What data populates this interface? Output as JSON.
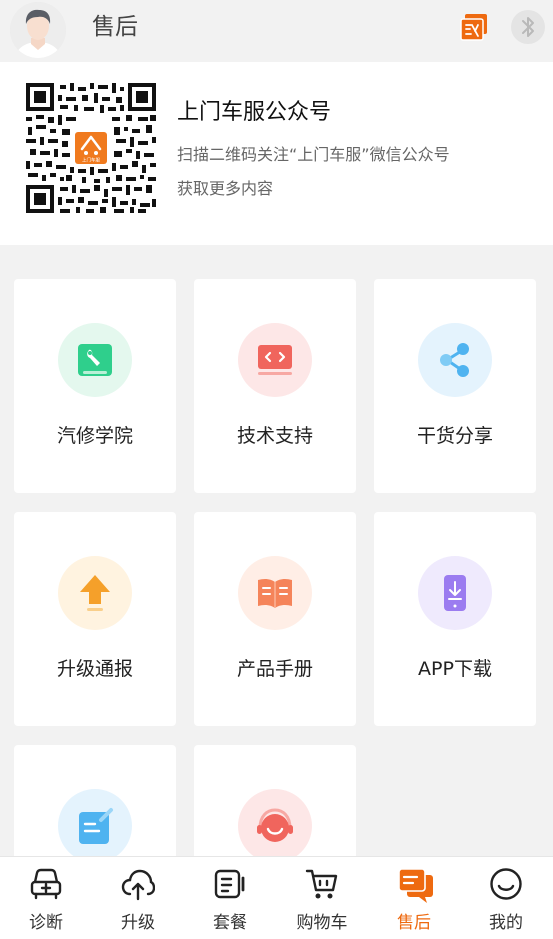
{
  "header": {
    "title": "售后"
  },
  "qr_card": {
    "title": "上门车服公众号",
    "subtitle": "扫描二维码关注“上门车服”微信公众号",
    "more": "获取更多内容",
    "logo_text": "上门车服"
  },
  "grid": {
    "items": [
      {
        "label": "汽修学院",
        "icon": "wrench-book-icon",
        "bg": "#e4f8ee",
        "color": "#2fcf8c"
      },
      {
        "label": "技术支持",
        "icon": "code-laptop-icon",
        "bg": "#fde7e7",
        "color": "#f0655d"
      },
      {
        "label": "干货分享",
        "icon": "share-icon",
        "bg": "#e4f3fd",
        "color": "#4fb3f0"
      },
      {
        "label": "升级通报",
        "icon": "upgrade-arrow-icon",
        "bg": "#fff3e0",
        "color": "#f5a02a"
      },
      {
        "label": "产品手册",
        "icon": "manual-book-icon",
        "bg": "#ffeee6",
        "color": "#f5845a"
      },
      {
        "label": "APP下载",
        "icon": "app-download-icon",
        "bg": "#efeafd",
        "color": "#9b7cf0"
      },
      {
        "label": "",
        "icon": "notepad-icon",
        "bg": "#e4f3fd",
        "color": "#4fb3f0"
      },
      {
        "label": "",
        "icon": "customer-service-icon",
        "bg": "#fde7e7",
        "color": "#f0655d"
      }
    ]
  },
  "tabbar": {
    "tabs": [
      {
        "label": "诊断",
        "icon": "diagnose-icon"
      },
      {
        "label": "升级",
        "icon": "cloud-upload-icon"
      },
      {
        "label": "套餐",
        "icon": "package-video-icon"
      },
      {
        "label": "购物车",
        "icon": "cart-icon"
      },
      {
        "label": "售后",
        "icon": "after-sales-icon",
        "active": true
      },
      {
        "label": "我的",
        "icon": "smile-icon"
      }
    ]
  },
  "colors": {
    "accent": "#ee6a10",
    "background": "#f2f2f2"
  }
}
